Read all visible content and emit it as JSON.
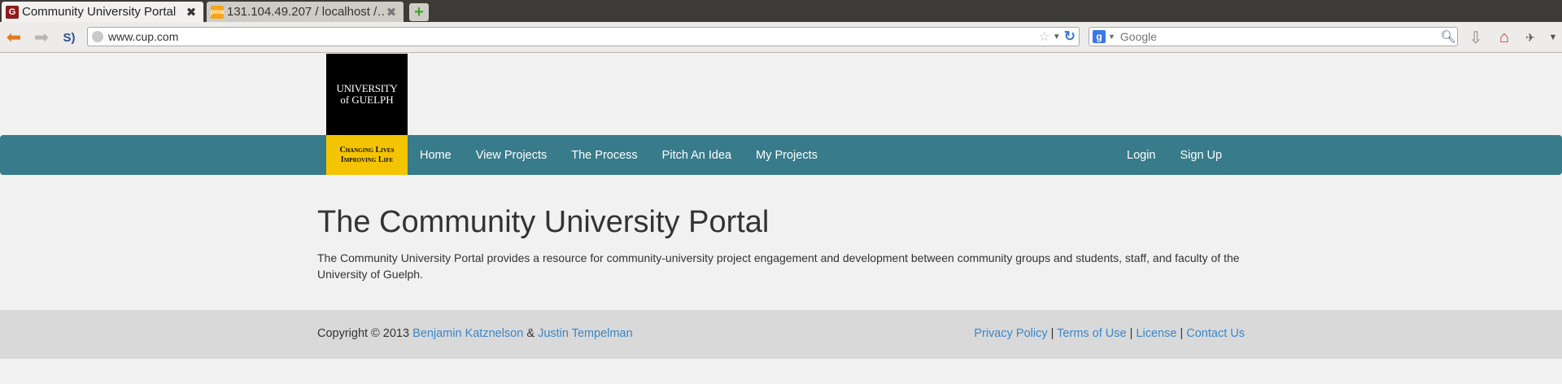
{
  "browser": {
    "tabs": [
      {
        "title": "Community University Portal",
        "favicon": "G",
        "active": true
      },
      {
        "title": "131.104.49.207 / localhost /…",
        "favicon": "pma",
        "active": false
      }
    ],
    "url": "www.cup.com",
    "search_placeholder": "Google",
    "icons": {
      "back": "back-arrow-icon",
      "forward": "forward-arrow-icon",
      "bookmark": "star-icon",
      "reload": "reload-icon",
      "download": "download-icon",
      "home": "home-icon"
    }
  },
  "site": {
    "logo": {
      "line1": "UNIVERSITY",
      "line2": "of GUELPH",
      "tagline1": "Changing Lives",
      "tagline2": "Improving Life"
    },
    "nav_left": [
      "Home",
      "View Projects",
      "The Process",
      "Pitch An Idea",
      "My Projects"
    ],
    "nav_right": [
      "Login",
      "Sign Up"
    ],
    "title": "The Community University Portal",
    "description": "The Community University Portal provides a resource for community-university project engagement and development between community groups and students, staff, and faculty of the University of Guelph.",
    "footer": {
      "copyright": "Copyright © 2013",
      "author1": "Benjamin Katznelson",
      "amp": "&",
      "author2": "Justin Tempelman",
      "links": [
        "Privacy Policy",
        "Terms of Use",
        "License",
        "Contact Us"
      ],
      "separator": "|"
    },
    "colors": {
      "navbar": "#387b8b",
      "logo_accent": "#f5c400",
      "link": "#3a87c8"
    }
  }
}
